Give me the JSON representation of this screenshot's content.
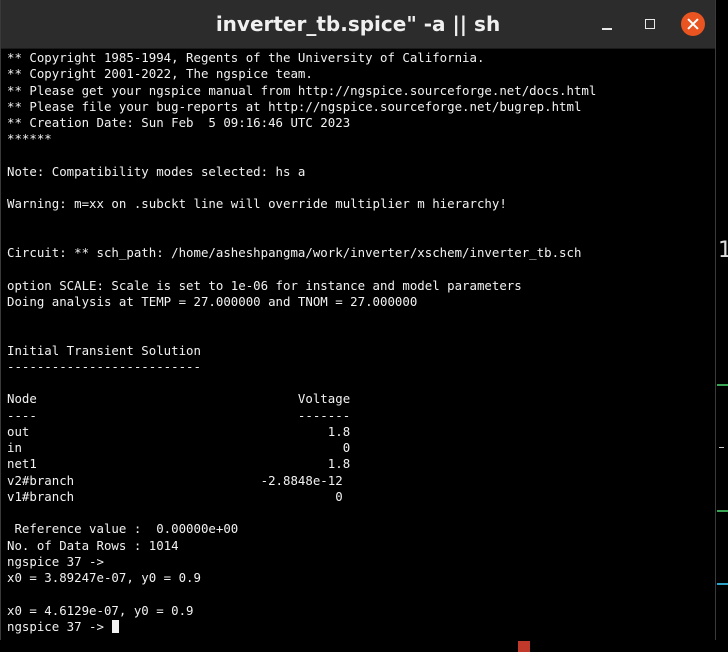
{
  "window": {
    "title": "inverter_tb.spice\" -a || sh"
  },
  "colors": {
    "titlebar": "#2c2c2c",
    "terminal_bg": "#000000",
    "terminal_fg": "#f2f2f2",
    "close_button": "#e95420"
  },
  "icons": {
    "minimize": "minimize-icon",
    "maximize": "maximize-icon",
    "close": "close-icon"
  },
  "terminal": {
    "lines": [
      "** Copyright 1985-1994, Regents of the University of California.",
      "** Copyright 2001-2022, The ngspice team.",
      "** Please get your ngspice manual from http://ngspice.sourceforge.net/docs.html",
      "** Please file your bug-reports at http://ngspice.sourceforge.net/bugrep.html",
      "** Creation Date: Sun Feb  5 09:16:46 UTC 2023",
      "******",
      "",
      "Note: Compatibility modes selected: hs a",
      "",
      "Warning: m=xx on .subckt line will override multiplier m hierarchy!",
      "",
      "",
      "Circuit: ** sch_path: /home/asheshpangma/work/inverter/xschem/inverter_tb.sch",
      "",
      "option SCALE: Scale is set to 1e-06 for instance and model parameters",
      "Doing analysis at TEMP = 27.000000 and TNOM = 27.000000",
      "",
      "",
      "Initial Transient Solution",
      "--------------------------",
      "",
      "Node                                   Voltage",
      "----                                   -------",
      "out                                        1.8",
      "in                                           0",
      "net1                                       1.8",
      "v2#branch                         -2.8848e-12",
      "v1#branch                                   0",
      "",
      " Reference value :  0.00000e+00",
      "No. of Data Rows : 1014",
      "ngspice 37 ->",
      "x0 = 3.89247e-07, y0 = 0.9",
      "",
      "x0 = 4.6129e-07, y0 = 0.9"
    ],
    "prompt": "ngspice 37 -> "
  },
  "background": {
    "glyph": "1"
  }
}
